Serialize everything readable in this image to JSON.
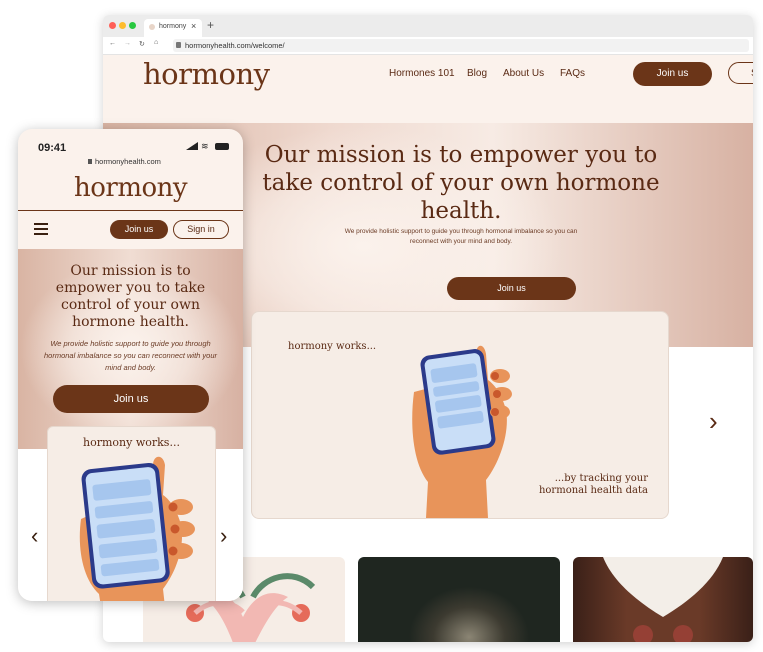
{
  "desktop": {
    "browser": {
      "tab_title": "hormony",
      "tab_close": "×",
      "new_tab": "+",
      "url": "hormonyhealth.com/welcome/"
    },
    "header": {
      "logo": "hormony",
      "nav": [
        "Hormones 101",
        "Blog",
        "About Us",
        "FAQs"
      ],
      "join_label": "Join us",
      "signin_partial": "S"
    },
    "hero": {
      "title": "Our mission is to empower you to take control of your own hormone health.",
      "subtitle": "We provide holistic support to guide you through hormonal imbalance so you can reconnect with your mind and body.",
      "cta": "Join us"
    },
    "carousel": {
      "heading": "hormony works...",
      "caption": "...by tracking your hormonal health data",
      "next_arrow": "›"
    }
  },
  "mobile": {
    "time": "09:41",
    "url": "hormonyhealth.com",
    "logo": "hormony",
    "join_label": "Join us",
    "signin_label": "Sign in",
    "hero": {
      "title": "Our mission is to empower you to take control of your own hormone health.",
      "subtitle": "We provide holistic support to guide you through hormonal imbalance so you can reconnect with your mind and body.",
      "cta": "Join us"
    },
    "carousel": {
      "heading": "hormony works...",
      "prev_arrow": "‹",
      "next_arrow": "›"
    }
  },
  "colors": {
    "brand_brown": "#6b3518",
    "cream": "#fbf2ec",
    "blush": "#d9b4a3",
    "phone_blue": "#bcd6f5",
    "skin": "#e8945a"
  }
}
